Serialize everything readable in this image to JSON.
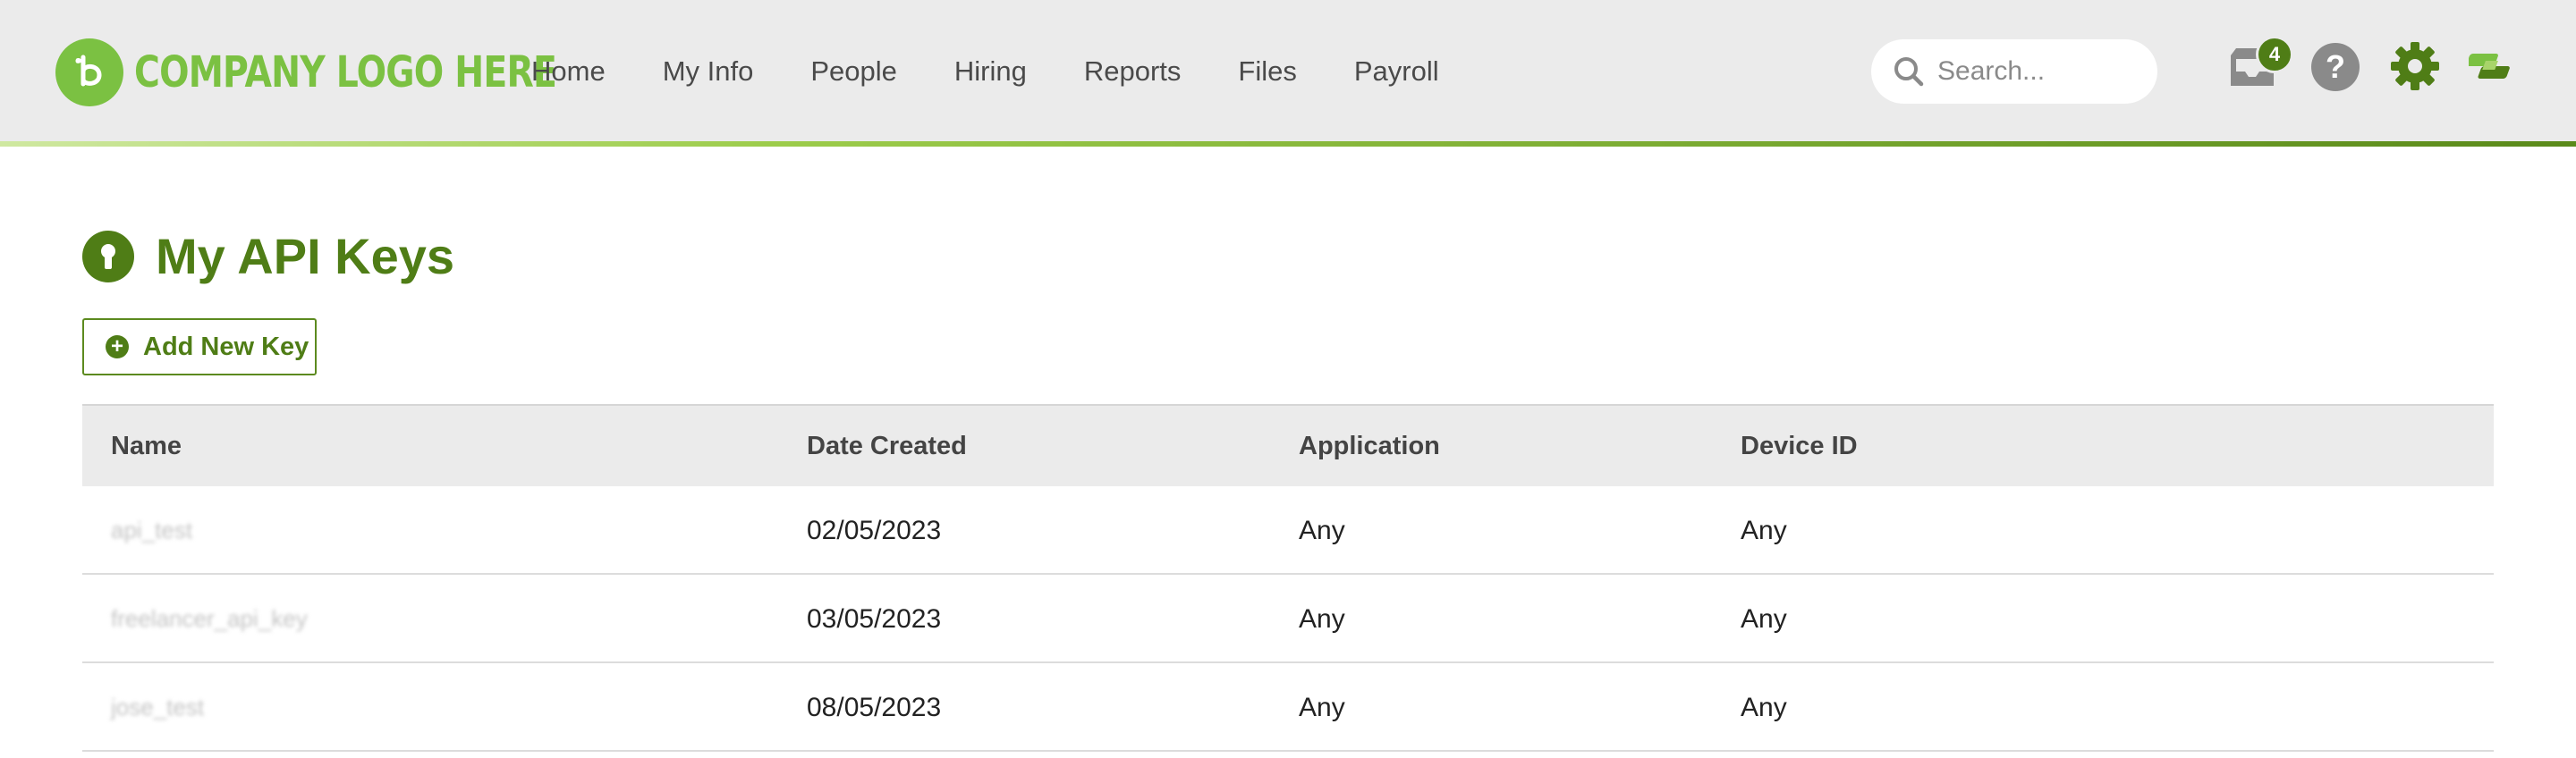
{
  "header": {
    "logo_text": "COMPANY LOGO HERE",
    "nav": [
      "Home",
      "My Info",
      "People",
      "Hiring",
      "Reports",
      "Files",
      "Payroll"
    ],
    "search": {
      "placeholder": "Search..."
    },
    "inbox_badge": "4",
    "help_glyph": "?",
    "icons": [
      "search-icon",
      "inbox-icon",
      "help-icon",
      "gear-icon",
      "apps-icon"
    ],
    "accent_color": "#7bc142"
  },
  "main": {
    "title": "My API Keys",
    "add_button_label": "Add New Key",
    "table": {
      "columns": [
        "Name",
        "Date Created",
        "Application",
        "Device ID"
      ],
      "rows": [
        {
          "name": "api_test",
          "date": "02/05/2023",
          "application": "Any",
          "device": "Any"
        },
        {
          "name": "freelancer_api_key",
          "date": "03/05/2023",
          "application": "Any",
          "device": "Any"
        },
        {
          "name": "jose_test",
          "date": "08/05/2023",
          "application": "Any",
          "device": "Any"
        }
      ]
    }
  },
  "colors": {
    "brand_dark": "#4f7d16",
    "brand_light": "#7bc142",
    "header_bg": "#ebebeb"
  }
}
